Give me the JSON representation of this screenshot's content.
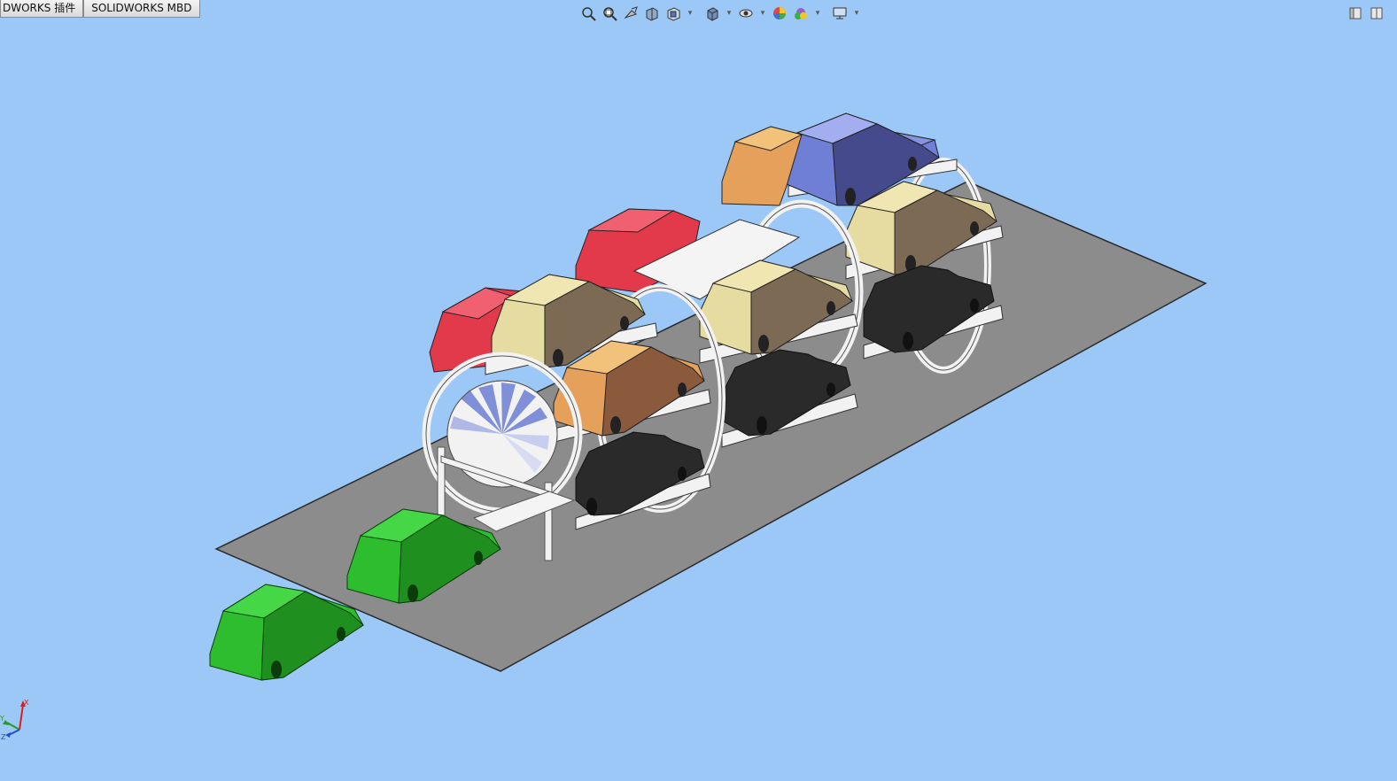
{
  "tabs": [
    {
      "label": "DWORKS 插件"
    },
    {
      "label": "SOLIDWORKS MBD"
    }
  ],
  "heads_up_toolbar": {
    "buttons": [
      "zoom-to-fit-icon",
      "zoom-to-area-icon",
      "previous-view-icon",
      "section-view-icon",
      "view-orientation-icon",
      "display-style-icon",
      "hide-show-items-icon",
      "edit-appearance-icon",
      "apply-scene-icon",
      "view-settings-icon"
    ]
  },
  "triad": {
    "x_label": "X",
    "y_label": "Y",
    "z_label": "Z"
  },
  "colors": {
    "background": "#9cc8f7",
    "floor": "#8c8c8c",
    "car_green": "#2ebd2e",
    "car_black": "#2a2a2a",
    "car_cream": "#e6dba0",
    "car_orange": "#e5a15c",
    "car_red": "#e23a4a",
    "car_blue": "#6f7fd6",
    "frame": "#f2f2f2"
  }
}
